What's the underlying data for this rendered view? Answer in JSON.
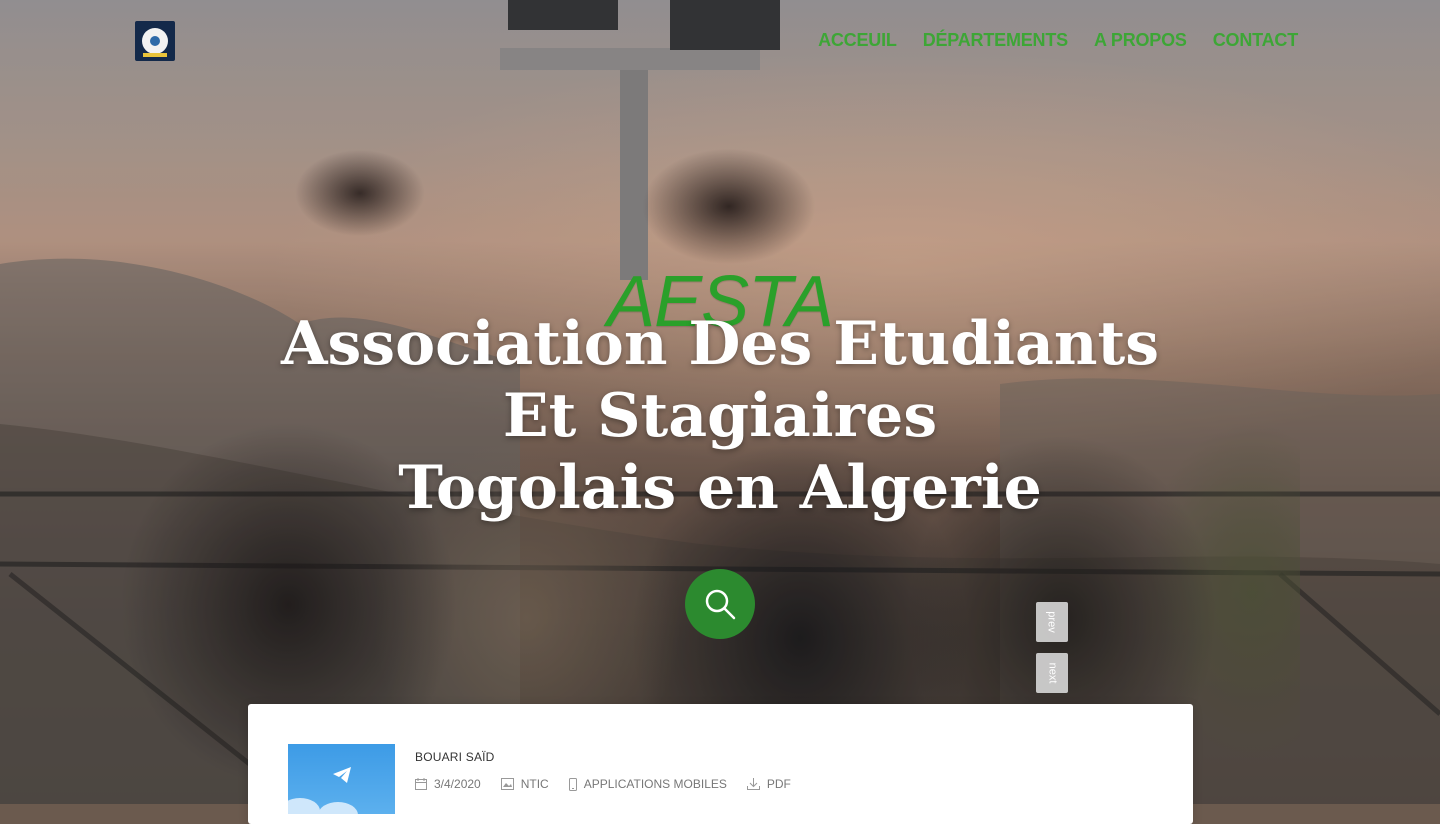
{
  "header": {
    "logo_text": "AESTA",
    "nav": [
      {
        "label": "ACCEUIL"
      },
      {
        "label": "DÉPARTEMENTS"
      },
      {
        "label": "A PROPOS"
      },
      {
        "label": "CONTACT"
      }
    ]
  },
  "hero": {
    "brand": "AESTA",
    "headline_lines": [
      "Association Des Etudiants",
      "Et Stagiaires",
      "Togolais en Algerie"
    ],
    "prev_label": "prev",
    "next_label": "next"
  },
  "card": {
    "author": "BOUARI SAÏD",
    "meta": [
      {
        "icon": "calendar-icon",
        "text": "3/4/2020"
      },
      {
        "icon": "image-icon",
        "text": "NTIC"
      },
      {
        "icon": "mobile-icon",
        "text": "APPLICATIONS MOBILES"
      },
      {
        "icon": "download-icon",
        "text": "PDF"
      }
    ]
  },
  "colors": {
    "accent": "#3da636",
    "search_button": "#2c8a2f"
  }
}
